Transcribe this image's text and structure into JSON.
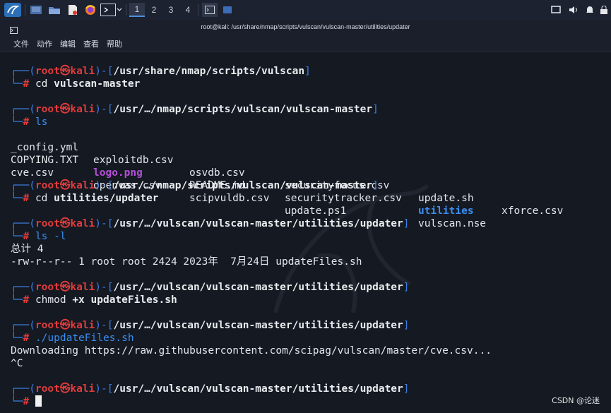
{
  "taskbar": {
    "workspaces": [
      "1",
      "2",
      "3",
      "4"
    ],
    "icons": [
      "kali-menu-icon",
      "desktop-icon",
      "files-icon",
      "text-editor-icon",
      "firefox-icon",
      "terminal-icon"
    ]
  },
  "window": {
    "title": "root@kali: /usr/share/nmap/scripts/vulscan/vulscan-master/utilities/updater"
  },
  "menu": [
    "文件",
    "动作",
    "编辑",
    "查看",
    "帮助"
  ],
  "prompt": {
    "user": "root",
    "at": "㉿",
    "host": "kali"
  },
  "blocks": [
    {
      "path": "/usr/share/nmap/scripts/vulscan",
      "cmd_main": "cd",
      "cmd_rest": " vulscan-master"
    },
    {
      "path": "/usr/…/nmap/scripts/vulscan/vulscan-master",
      "cmd_main": "ls",
      "cmd_rest": ""
    },
    {
      "path": "/usr/…/nmap/scripts/vulscan/vulscan-master",
      "cmd_main": "cd",
      "cmd_rest": " utilities/updater"
    },
    {
      "path": "/usr/…/vulscan/vulscan-master/utilities/updater",
      "cmd_main": "ls",
      "cmd_rest": " -l"
    },
    {
      "path": "/usr/…/vulscan/vulscan-master/utilities/updater",
      "cmd_main": "chmod",
      "cmd_rest": " +x updateFiles.sh"
    },
    {
      "path": "/usr/…/vulscan/vulscan-master/utilities/updater",
      "cmd_main": "./updateFiles.sh",
      "cmd_rest": ""
    },
    {
      "path": "/usr/…/vulscan/vulscan-master/utilities/updater",
      "cmd_main": "",
      "cmd_rest": ""
    }
  ],
  "ls_output": [
    [
      "_config.yml",
      "exploitdb.csv",
      "osvdb.csv",
      "securityfocus.csv",
      "update.sh",
      "xforce.csv"
    ],
    [
      "COPYING.TXT",
      "logo.png",
      "README.md",
      "securitytracker.csv",
      "utilities",
      ""
    ],
    [
      "cve.csv",
      "openvas.csv",
      "scipvuldb.csv",
      "update.ps1",
      "vulscan.nse",
      ""
    ]
  ],
  "ls_l_output": [
    "总计 4",
    "-rw-r--r-- 1 root root 2424 2023年  7月24日 updateFiles.sh"
  ],
  "update_output": [
    "Downloading https://raw.githubusercontent.com/scipag/vulscan/master/cve.csv...",
    "^C"
  ],
  "watermark": "CSDN @论迷"
}
